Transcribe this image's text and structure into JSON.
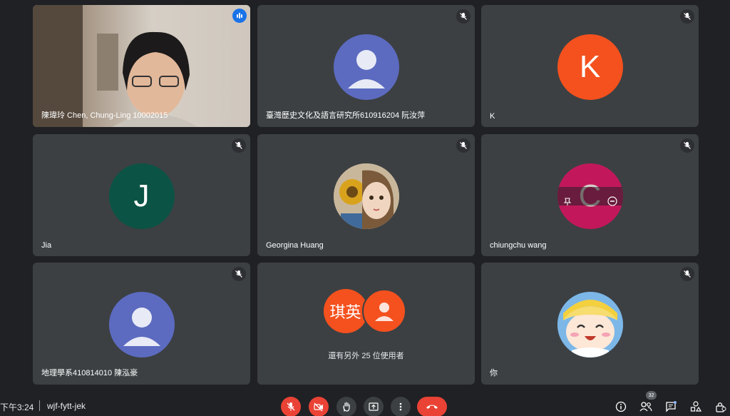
{
  "participants": [
    {
      "name": "陳瑋玲 Chen, Chung-Ling 10002015",
      "status": "speaking"
    },
    {
      "name": "臺灣歷史文化及語言研究所610916204 阮汝萍",
      "status": "muted"
    },
    {
      "name": "K",
      "initial": "K",
      "status": "muted"
    },
    {
      "name": "Jia",
      "initial": "J",
      "status": "muted"
    },
    {
      "name": "Georgina Huang",
      "status": "muted"
    },
    {
      "name": "chiungchu wang",
      "initial": "C",
      "status": "muted"
    },
    {
      "name": "地理學系410814010 陳泓豪",
      "status": "muted"
    },
    {
      "name": "你",
      "status": "muted"
    }
  ],
  "others_tile": {
    "avatar_text": "琪英",
    "label": "還有另外 25 位使用者"
  },
  "bottom_bar": {
    "time": "下午3:24",
    "separator": "|",
    "meeting_code": "wjf-fytt-jek",
    "people_count": "32"
  },
  "colors": {
    "background": "#202124",
    "tile": "#3c4043",
    "danger": "#ea4335",
    "speaking_outline": "#8ab4f8"
  },
  "icons": {
    "mic_off": "mic-off-icon",
    "speaking": "speaking-indicator-icon",
    "camera_off": "camera-off-icon",
    "raise_hand": "raise-hand-icon",
    "present": "present-screen-icon",
    "more": "more-options-icon",
    "end_call": "end-call-icon",
    "info": "info-icon",
    "people": "people-icon",
    "chat": "chat-icon",
    "activities": "activities-icon",
    "host_controls": "host-controls-icon",
    "pin": "pin-icon",
    "remove": "remove-icon"
  }
}
